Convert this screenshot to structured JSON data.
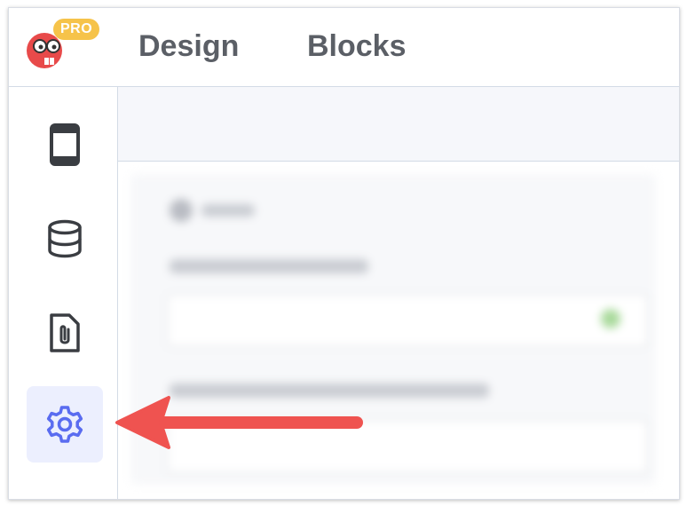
{
  "app": {
    "badge": "PRO",
    "logo_icon": "mascot-logo-icon"
  },
  "nav": {
    "tabs": [
      {
        "label": "Design"
      },
      {
        "label": "Blocks"
      }
    ]
  },
  "sidebar": {
    "items": [
      {
        "icon": "mobile-phone-icon",
        "active": false
      },
      {
        "icon": "database-icon",
        "active": false
      },
      {
        "icon": "file-attachment-icon",
        "active": false
      },
      {
        "icon": "gear-icon",
        "active": true
      }
    ]
  },
  "colors": {
    "accent": "#5a6cf0",
    "active_bg": "#eceffe",
    "badge": "#f6c34a",
    "arrow": "#ef5350"
  }
}
